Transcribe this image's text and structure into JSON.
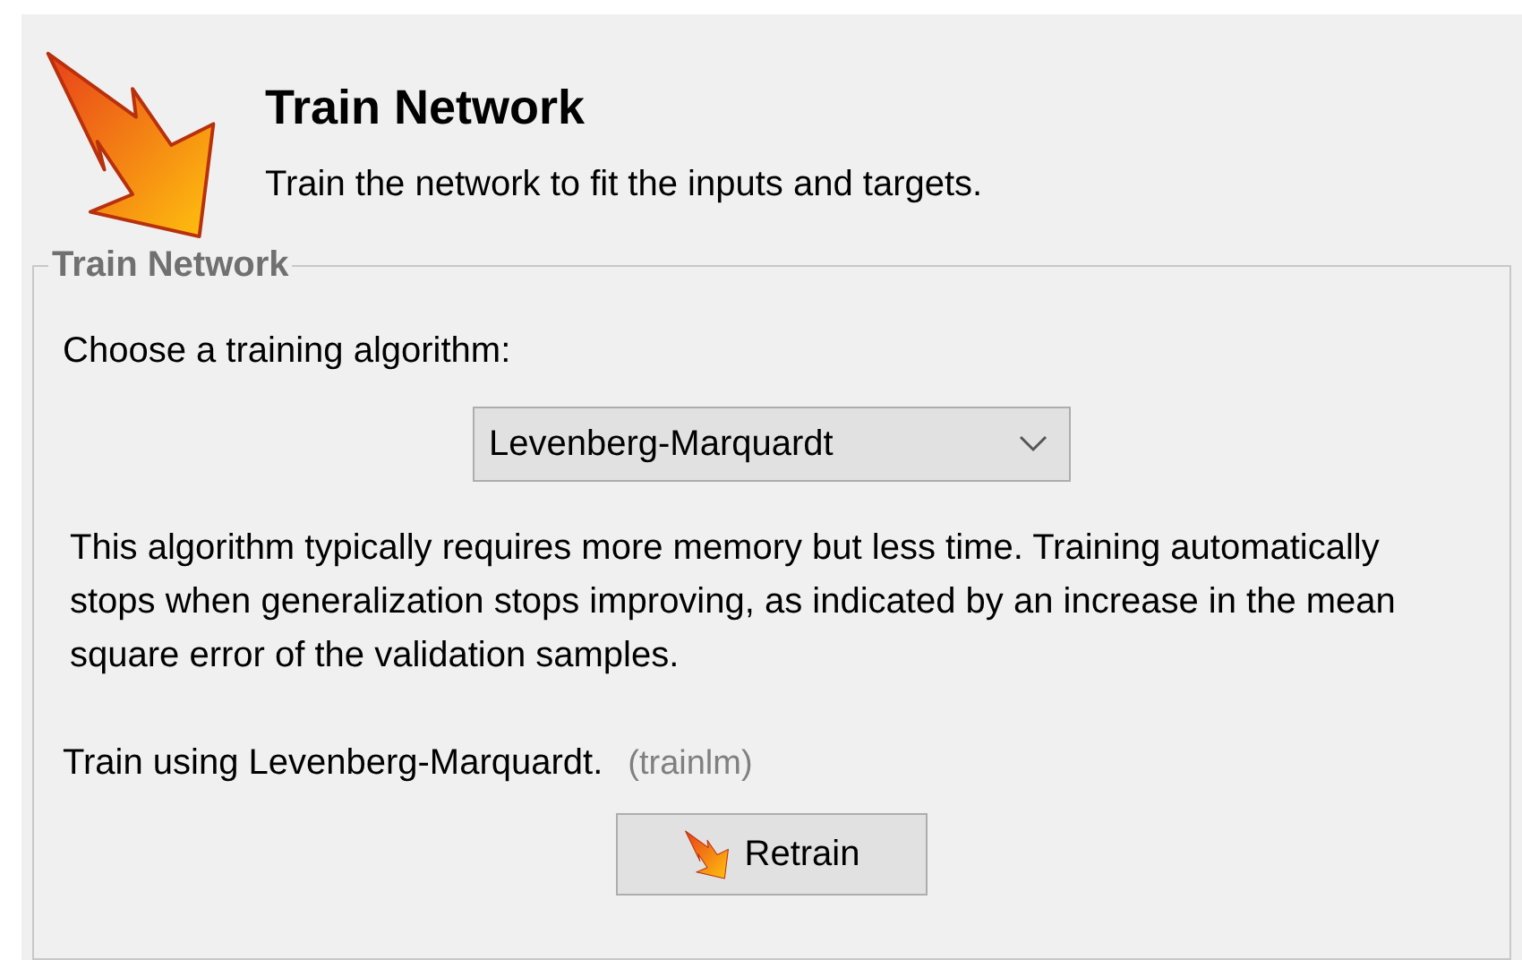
{
  "header": {
    "title": "Train Network",
    "subtitle": "Train the network to fit the inputs and targets."
  },
  "group": {
    "title": "Train Network",
    "algorithm_label": "Choose a training algorithm:",
    "algorithm_select": {
      "value": "Levenberg-Marquardt"
    },
    "description": "This algorithm typically requires more memory but less time. Training automatically stops when generalization stops improving, as indicated by an increase in the mean square error of the validation samples.",
    "train_using": "Train using Levenberg-Marquardt.",
    "function_name": "(trainlm)",
    "button": "Retrain"
  }
}
